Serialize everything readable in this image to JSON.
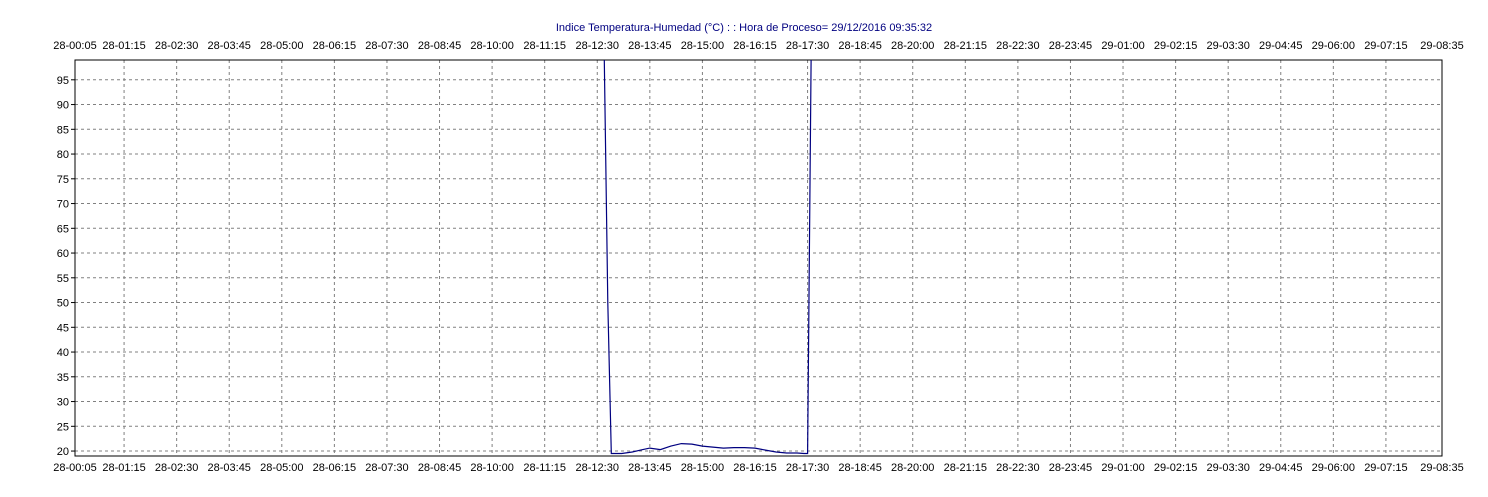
{
  "chart_data": {
    "type": "line",
    "title": "Indice Temperatura-Humedad (°C) : : Hora de Proceso= 29/12/2016 09:35:32",
    "xlabel": "",
    "ylabel": "",
    "x_tick_labels": [
      "28-00:05",
      "28-01:15",
      "28-02:30",
      "28-03:45",
      "28-05:00",
      "28-06:15",
      "28-07:30",
      "28-08:45",
      "28-10:00",
      "28-11:15",
      "28-12:30",
      "28-13:45",
      "28-15:00",
      "28-16:15",
      "28-17:30",
      "28-18:45",
      "28-20:00",
      "28-21:15",
      "28-22:30",
      "28-23:45",
      "29-01:00",
      "29-02:15",
      "29-03:30",
      "29-04:45",
      "29-06:00",
      "29-07:15",
      "29-08:35"
    ],
    "y_ticks": [
      20,
      25,
      30,
      35,
      40,
      45,
      50,
      55,
      60,
      65,
      70,
      75,
      80,
      85,
      90,
      95
    ],
    "ylim": [
      19,
      99
    ],
    "grid": true,
    "colors": {
      "series": "#000080",
      "title": "#000080",
      "axis": "#000000",
      "grid": "#808080"
    },
    "series": [
      {
        "x": [
          "28-12:40",
          "28-12:45",
          "28-12:50",
          "28-13:05",
          "28-13:20",
          "28-13:35",
          "28-13:45",
          "28-14:00",
          "28-14:15",
          "28-14:30",
          "28-14:45",
          "28-15:00",
          "28-15:15",
          "28-15:30",
          "28-15:45",
          "28-16:00",
          "28-16:15",
          "28-16:30",
          "28-16:45",
          "28-17:00",
          "28-17:15",
          "28-17:25",
          "28-17:30",
          "28-17:35"
        ],
        "values": [
          99,
          50,
          19.5,
          19.5,
          19.8,
          20.3,
          20.6,
          20.3,
          21.0,
          21.5,
          21.4,
          21.0,
          20.8,
          20.6,
          20.7,
          20.7,
          20.6,
          20.2,
          19.8,
          19.6,
          19.6,
          19.5,
          19.5,
          99
        ]
      }
    ]
  }
}
